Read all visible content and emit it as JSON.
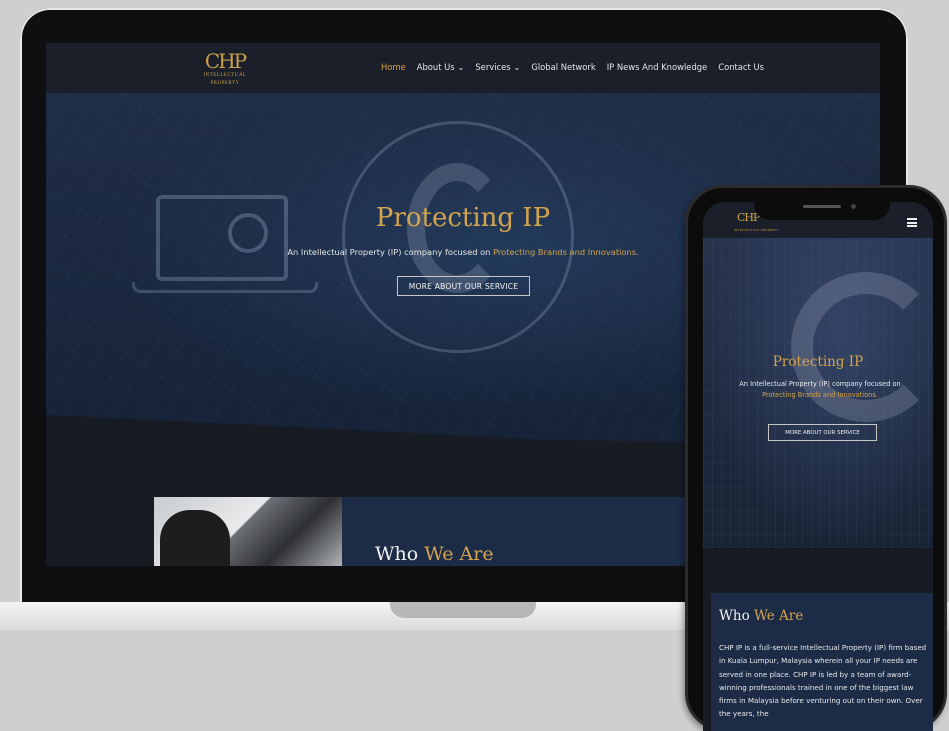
{
  "site": {
    "logo_mark": "CHP",
    "logo_sub": "INTELLECTUAL PROPERTY",
    "nav": [
      {
        "label": "Home"
      },
      {
        "label": "About Us ⌄"
      },
      {
        "label": "Services ⌄"
      },
      {
        "label": "Global Network"
      },
      {
        "label": "IP News And Knowledge"
      },
      {
        "label": "Contact Us"
      }
    ]
  },
  "hero": {
    "title": "Protecting IP",
    "tagline_start": "An Intellectual Property (IP) company focused on ",
    "tagline_highlight": "Protecting Brands and Innovations.",
    "button": "MORE ABOUT OUR SERVICE"
  },
  "who": {
    "word1": "Who ",
    "word2": "We Are",
    "body": "CHP IP is a full-service Intellectual Property (IP) firm based in Kuala Lumpur, Malaysia wherein all your IP needs are served in one place. CHP IP is led by a team of award-winning professionals trained in one of the biggest law firms in Malaysia before venturing out on their own. Over the years, the"
  },
  "colors": {
    "gold": "#d3a44d",
    "navy": "#1c2b46",
    "dark": "#171b24"
  },
  "icons": {
    "menu": "hamburger-menu-icon"
  }
}
